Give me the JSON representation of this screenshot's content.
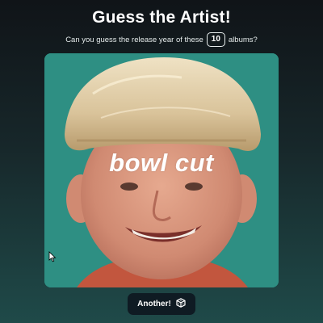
{
  "header": {
    "title": "Guess the Artist!",
    "subtitle_before": "Can you guess the release year of these",
    "album_count": "10",
    "subtitle_after": "albums?"
  },
  "album": {
    "cover_text": "bowl cut"
  },
  "actions": {
    "another_label": "Another!",
    "another_icon": "dice-icon"
  },
  "colors": {
    "background_top": "#101418",
    "background_bottom": "#1f4a49",
    "cover_background": "#2e8f83",
    "button_background": "#0f1b23"
  }
}
